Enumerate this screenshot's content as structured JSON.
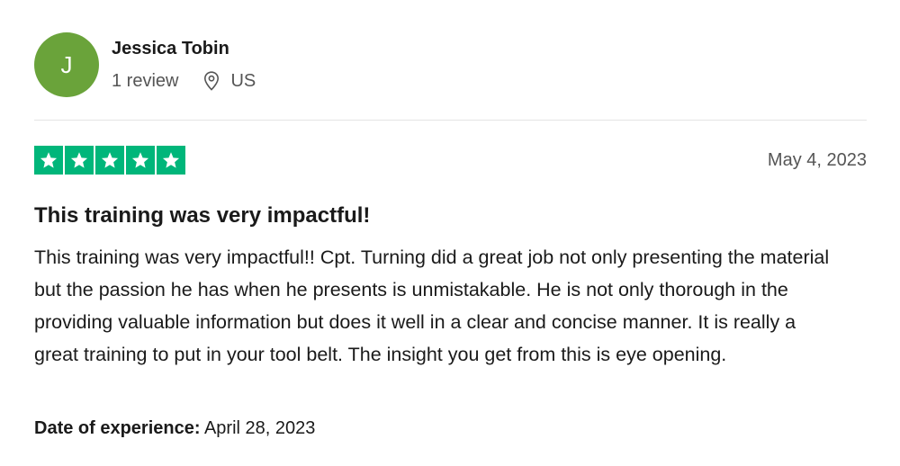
{
  "reviewer": {
    "initial": "J",
    "name": "Jessica Tobin",
    "review_count": "1 review",
    "country": "US",
    "avatar_color": "#6aa33a"
  },
  "review": {
    "rating": 5,
    "rating_max": 5,
    "star_color": "#00b67a",
    "date": "May 4, 2023",
    "title": "This training was very impactful!",
    "body": "This training was very impactful!! Cpt. Turning did a great job not only presenting the material but the passion he has when he presents is unmistakable. He is not only thorough in the providing valuable information but does it well in a clear and concise manner. It is really a great training to put in your tool belt. The insight you get from this is eye opening.",
    "experience_label": "Date of experience:",
    "experience_date": "April 28, 2023"
  },
  "icons": {
    "location": "location-pin-icon",
    "star": "star-icon"
  }
}
